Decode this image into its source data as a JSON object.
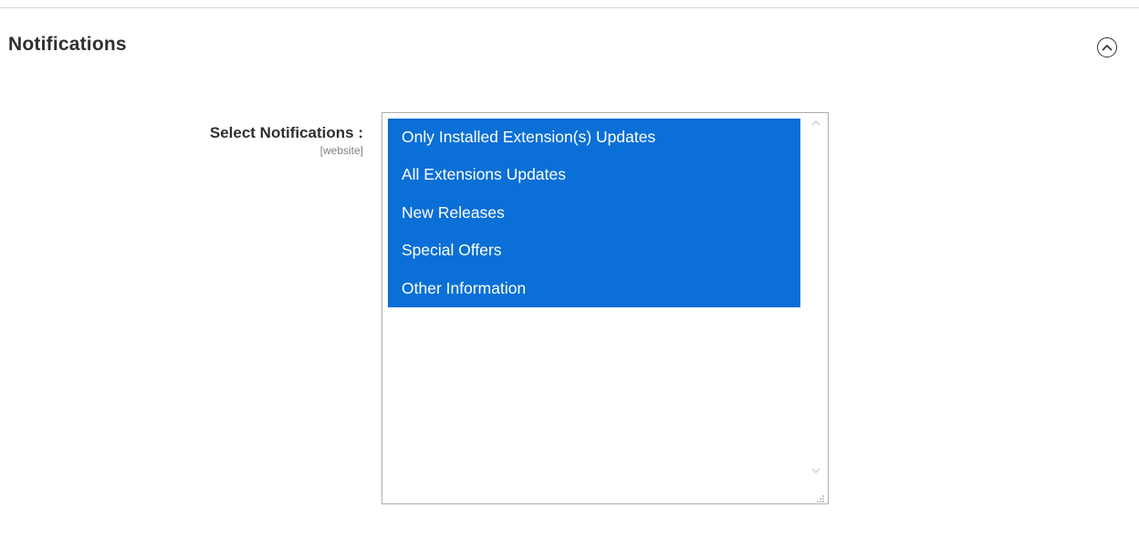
{
  "section": {
    "title": "Notifications",
    "toggle_icon": "chevron-up-circle-icon"
  },
  "field": {
    "label": "Select Notifications :",
    "scope": "[website]"
  },
  "options": [
    {
      "label": "Only Installed Extension(s) Updates",
      "selected": true
    },
    {
      "label": "All Extensions Updates",
      "selected": true
    },
    {
      "label": "New Releases",
      "selected": true
    },
    {
      "label": "Special Offers",
      "selected": true
    },
    {
      "label": "Other Information",
      "selected": true
    }
  ],
  "colors": {
    "selected_option_bg": "#0a6fd6",
    "selected_option_text": "#ffffff",
    "border": "#adadad"
  }
}
